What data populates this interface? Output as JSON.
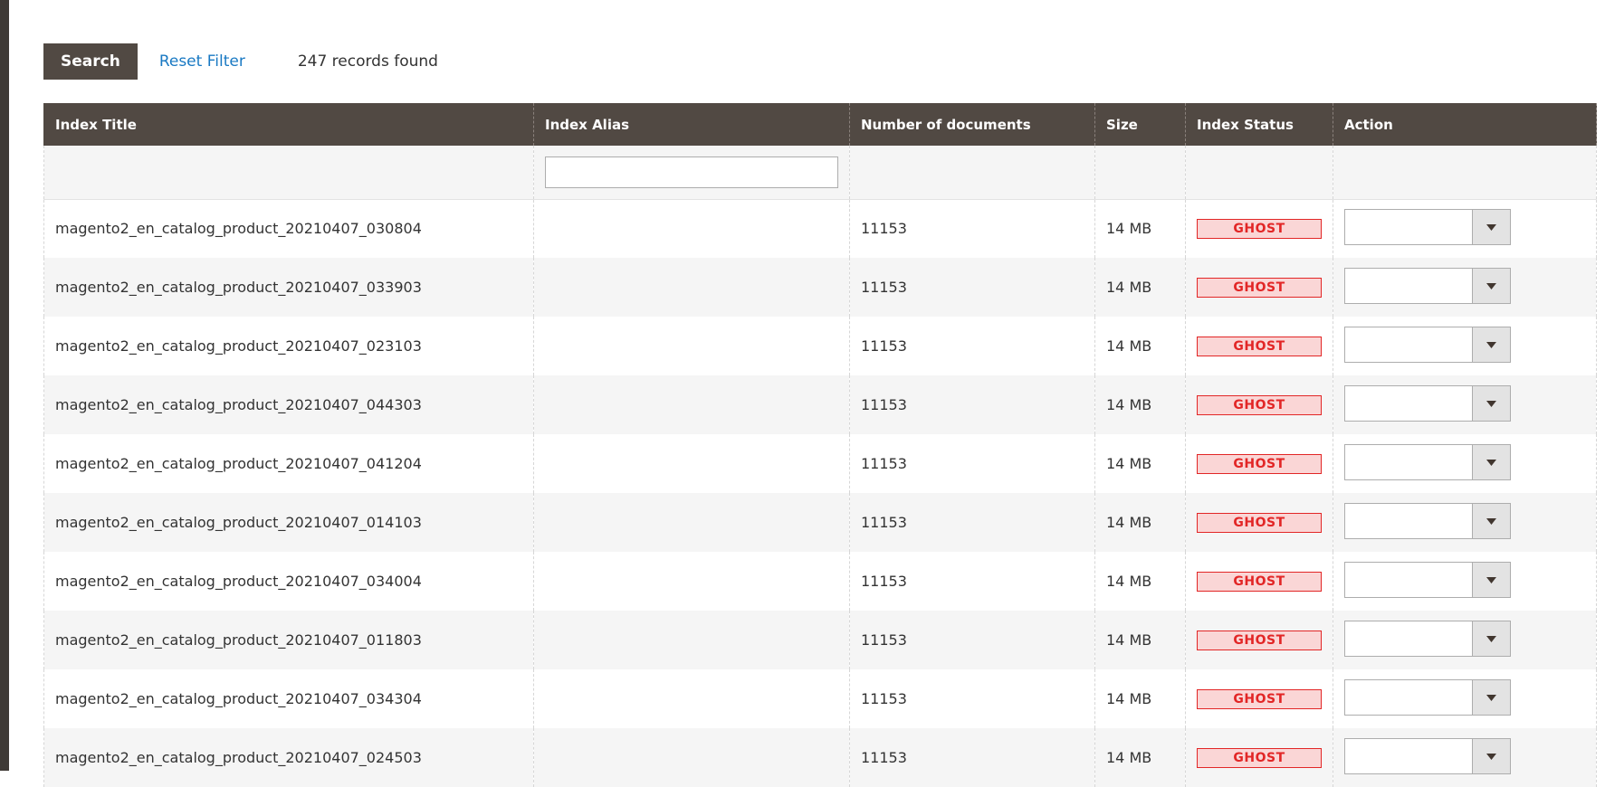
{
  "toolbar": {
    "search_label": "Search",
    "reset_label": "Reset Filter",
    "records_text": "247 records found"
  },
  "table": {
    "columns": [
      "Index Title",
      "Index Alias",
      "Number of documents",
      "Size",
      "Index Status",
      "Action"
    ],
    "alias_filter_placeholder": "",
    "rows": [
      {
        "title": "magento2_en_catalog_product_20210407_030804",
        "alias": "",
        "documents": "11153",
        "size": "14 MB",
        "status": "GHOST",
        "action": ""
      },
      {
        "title": "magento2_en_catalog_product_20210407_033903",
        "alias": "",
        "documents": "11153",
        "size": "14 MB",
        "status": "GHOST",
        "action": ""
      },
      {
        "title": "magento2_en_catalog_product_20210407_023103",
        "alias": "",
        "documents": "11153",
        "size": "14 MB",
        "status": "GHOST",
        "action": ""
      },
      {
        "title": "magento2_en_catalog_product_20210407_044303",
        "alias": "",
        "documents": "11153",
        "size": "14 MB",
        "status": "GHOST",
        "action": ""
      },
      {
        "title": "magento2_en_catalog_product_20210407_041204",
        "alias": "",
        "documents": "11153",
        "size": "14 MB",
        "status": "GHOST",
        "action": ""
      },
      {
        "title": "magento2_en_catalog_product_20210407_014103",
        "alias": "",
        "documents": "11153",
        "size": "14 MB",
        "status": "GHOST",
        "action": ""
      },
      {
        "title": "magento2_en_catalog_product_20210407_034004",
        "alias": "",
        "documents": "11153",
        "size": "14 MB",
        "status": "GHOST",
        "action": ""
      },
      {
        "title": "magento2_en_catalog_product_20210407_011803",
        "alias": "",
        "documents": "11153",
        "size": "14 MB",
        "status": "GHOST",
        "action": ""
      },
      {
        "title": "magento2_en_catalog_product_20210407_034304",
        "alias": "",
        "documents": "11153",
        "size": "14 MB",
        "status": "GHOST",
        "action": ""
      },
      {
        "title": "magento2_en_catalog_product_20210407_024503",
        "alias": "",
        "documents": "11153",
        "size": "14 MB",
        "status": "GHOST",
        "action": ""
      }
    ]
  },
  "colors": {
    "header_bg": "#514943",
    "link": "#1979c3",
    "status_ghost_text": "#e22626",
    "status_ghost_bg": "#fad6d6"
  },
  "icons": {
    "select_arrow": "chevron-down-icon"
  }
}
